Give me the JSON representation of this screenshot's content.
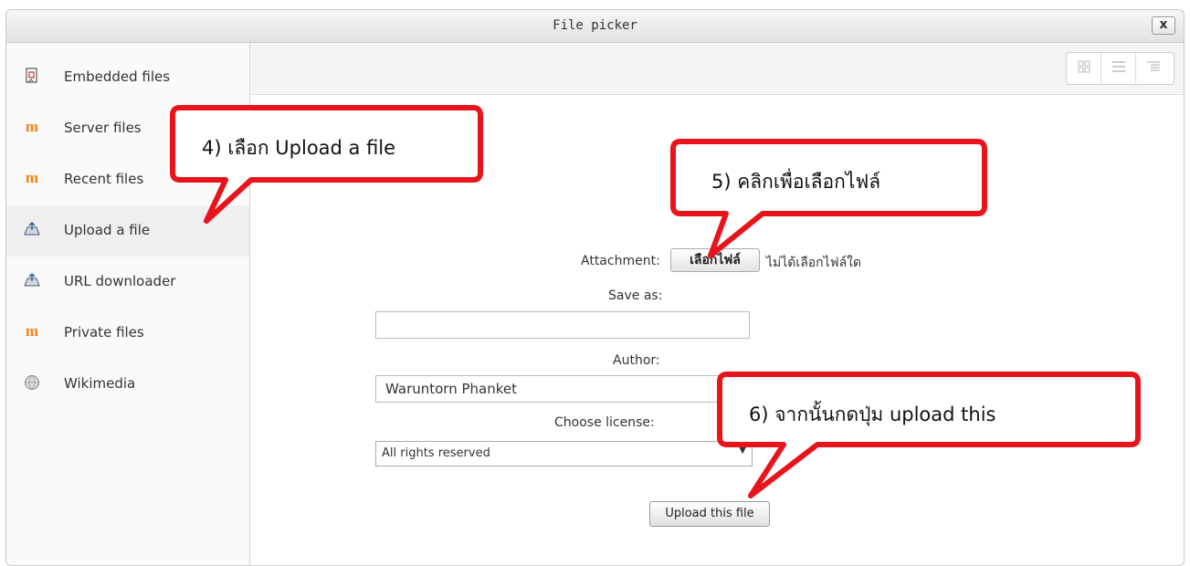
{
  "window": {
    "title": "File picker",
    "close_label": "x"
  },
  "sidebar": {
    "items": [
      {
        "label": "Embedded files",
        "icon": "file-icon"
      },
      {
        "label": "Server files",
        "icon": "moodle-icon"
      },
      {
        "label": "Recent files",
        "icon": "moodle-icon"
      },
      {
        "label": "Upload a file",
        "icon": "upload-icon",
        "active": true
      },
      {
        "label": "URL downloader",
        "icon": "upload-icon"
      },
      {
        "label": "Private files",
        "icon": "moodle-icon"
      },
      {
        "label": "Wikimedia",
        "icon": "globe-icon"
      }
    ]
  },
  "toolbar": {
    "views": [
      "grid-view-icon",
      "list-view-icon",
      "tree-view-icon"
    ]
  },
  "form": {
    "attachment_label": "Attachment:",
    "choose_file_label": "เลือกไฟล์",
    "no_file_text": "ไม่ได้เลือกไฟล์ใด",
    "save_as_label": "Save as:",
    "save_as_value": "",
    "author_label": "Author:",
    "author_value": "Waruntorn Phanket",
    "license_label": "Choose license:",
    "license_value": "All rights reserved",
    "upload_button_label": "Upload this file"
  },
  "callouts": {
    "step4": "4) เลือก  Upload a file",
    "step5": "5) คลิกเพื่อเลือกไฟล์",
    "step6": "6) จากนั้นกดปุ่ม upload  this"
  },
  "colors": {
    "callout_border": "#e8141b",
    "moodle_orange": "#f98012"
  }
}
